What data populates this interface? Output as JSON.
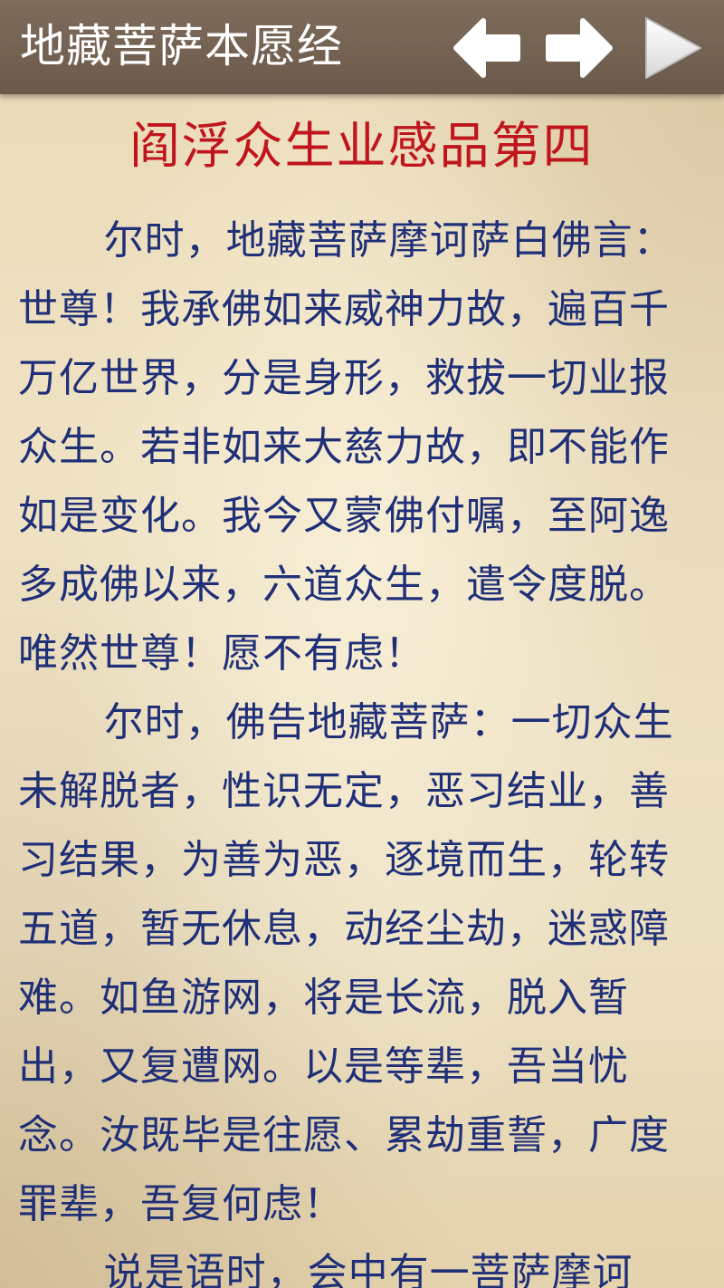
{
  "app_bar": {
    "title": "地藏菩萨本愿经",
    "back_label": "上一章",
    "forward_label": "下一章",
    "play_label": "播放",
    "icons": {
      "back": "arrow-left-icon",
      "forward": "arrow-right-icon",
      "play": "play-icon"
    },
    "colors": {
      "bar": "#6f5e4f",
      "icon": "#ffffff"
    }
  },
  "chapter": {
    "title": "阎浮众生业感品第四",
    "title_color": "#c0151c",
    "text_color": "#1f2f78",
    "paragraphs": [
      "尔时，地藏菩萨摩诃萨白佛言：世尊！我承佛如来威神力故，遍百千万亿世界，分是身形，救拔一切业报众生。若非如来大慈力故，即不能作如是变化。我今又蒙佛付嘱，至阿逸多成佛以来，六道众生，遣令度脱。唯然世尊！愿不有虑！",
      "尔时，佛告地藏菩萨：一切众生未解脱者，性识无定，恶习结业，善习结果，为善为恶，逐境而生，轮转五道，暂无休息，动经尘劫，迷惑障难。如鱼游网，将是长流，脱入暂出，又复遭网。以是等辈，吾当忧念。汝既毕是往愿、累劫重誓，广度罪辈，吾复何虑！",
      "说是语时，会中有一菩萨摩诃"
    ]
  }
}
